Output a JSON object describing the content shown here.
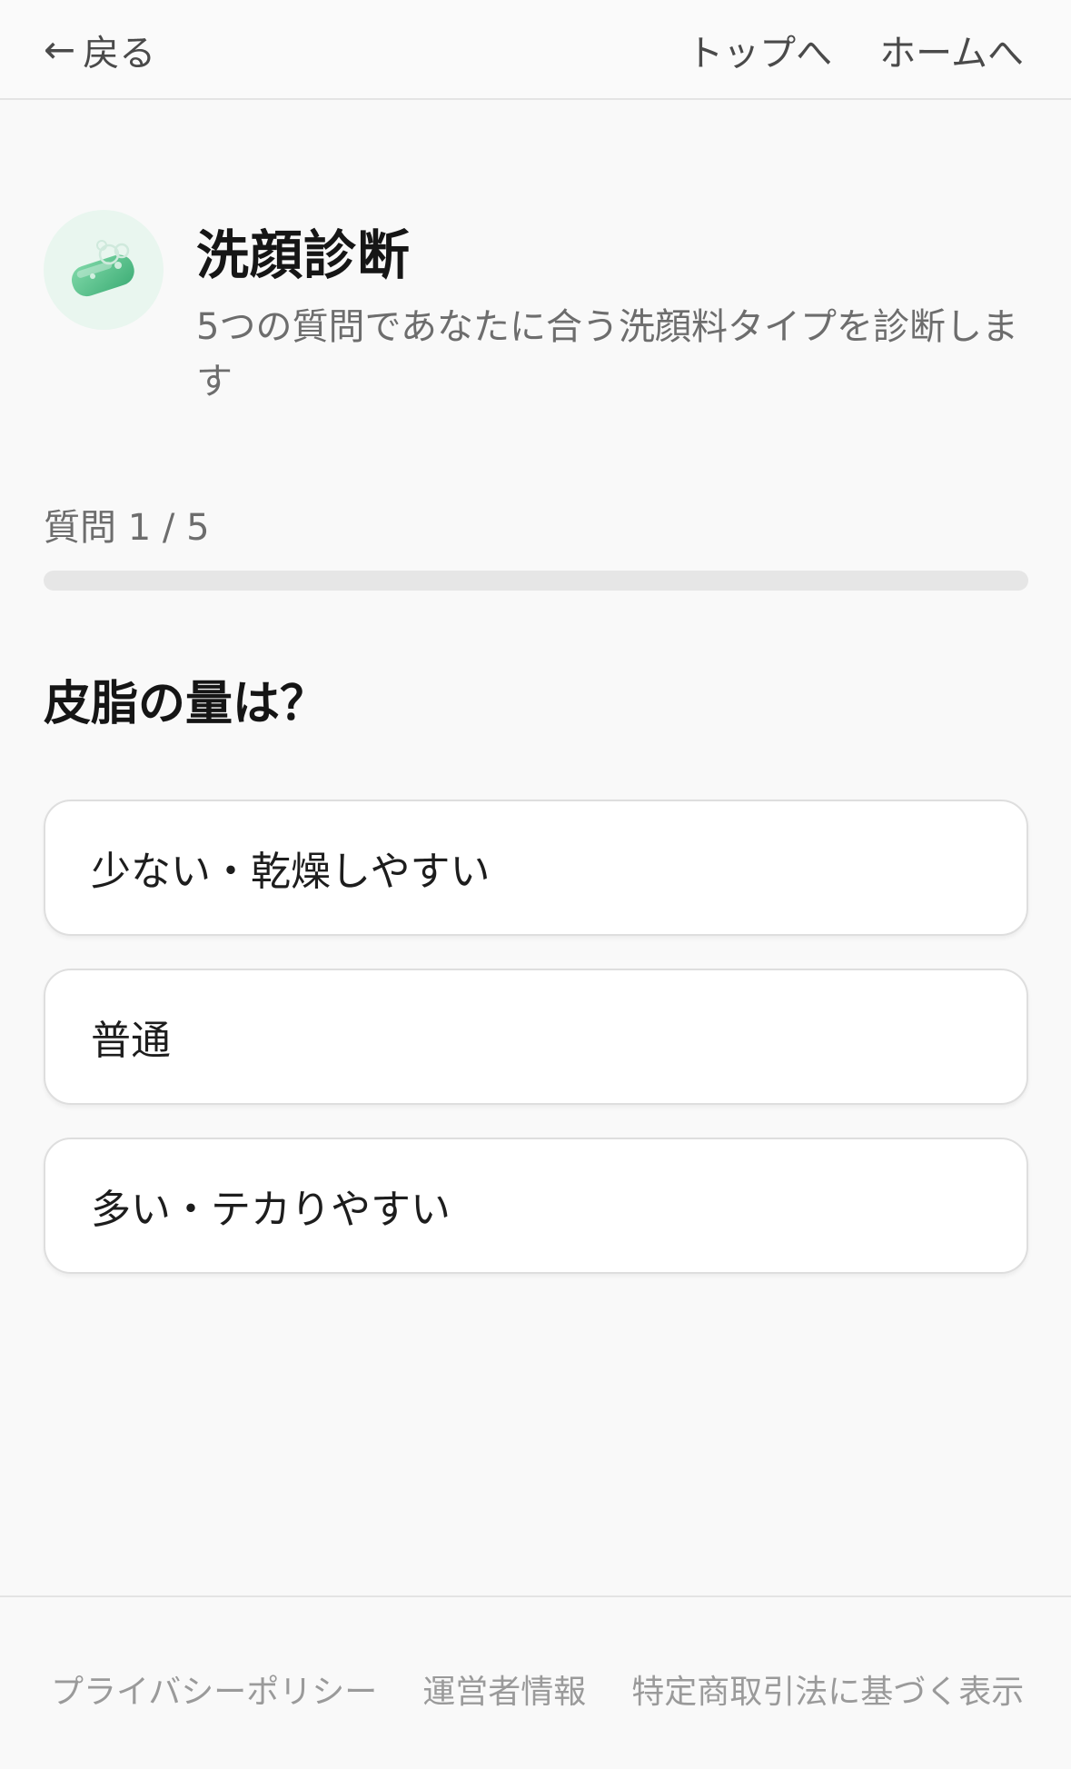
{
  "header": {
    "back_arrow": "←",
    "back_label": "戻る",
    "top_link": "トップへ",
    "home_link": "ホームへ"
  },
  "intro": {
    "icon": "soap-icon",
    "title": "洗顔診断",
    "description": "5つの質問であなたに合う洗顔料タイプを診断します"
  },
  "progress": {
    "label": "質問 1 / 5",
    "current": 1,
    "total": 5,
    "fill_fraction": 0,
    "accent_color": "#6cc59a"
  },
  "question": {
    "text": "皮脂の量は？",
    "options": [
      {
        "label": "少ない・乾燥しやすい"
      },
      {
        "label": "普通"
      },
      {
        "label": "多い・テカりやすい"
      }
    ]
  },
  "footer": {
    "links": [
      {
        "label": "プライバシーポリシー"
      },
      {
        "label": "運営者情報"
      },
      {
        "label": "特定商取引法に基づく表示"
      }
    ]
  }
}
